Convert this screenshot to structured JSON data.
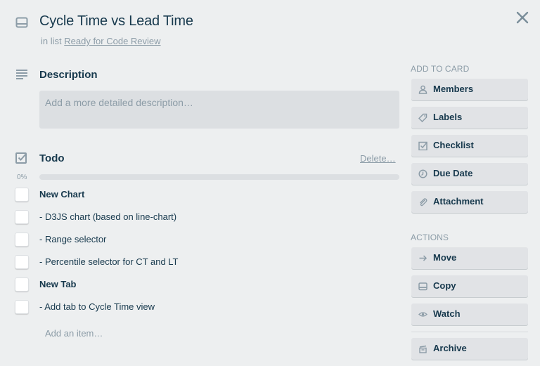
{
  "card": {
    "title": "Cycle Time vs Lead Time",
    "in_list_prefix": "in list",
    "list_name": "Ready for Code Review"
  },
  "description": {
    "heading": "Description",
    "placeholder": "Add a more detailed description…"
  },
  "checklist": {
    "heading": "Todo",
    "delete_label": "Delete…",
    "progress_label": "0%",
    "progress_percent": 0,
    "items": [
      {
        "text": "New Chart",
        "bold": true,
        "checked": false
      },
      {
        "text": "- D3JS chart (based on line-chart)",
        "bold": false,
        "checked": false
      },
      {
        "text": "- Range selector",
        "bold": false,
        "checked": false
      },
      {
        "text": "- Percentile selector for CT and LT",
        "bold": false,
        "checked": false
      },
      {
        "text": "New Tab",
        "bold": true,
        "checked": false
      },
      {
        "text": "- Add tab to Cycle Time view",
        "bold": false,
        "checked": false
      }
    ],
    "add_item_placeholder": "Add an item…"
  },
  "sidebar": {
    "add_to_card_heading": "ADD TO CARD",
    "add_to_card": [
      {
        "label": "Members",
        "icon": "person-icon"
      },
      {
        "label": "Labels",
        "icon": "tag-icon"
      },
      {
        "label": "Checklist",
        "icon": "checkbox-icon"
      },
      {
        "label": "Due Date",
        "icon": "clock-icon"
      },
      {
        "label": "Attachment",
        "icon": "paperclip-icon"
      }
    ],
    "actions_heading": "ACTIONS",
    "actions": [
      {
        "label": "Move",
        "icon": "arrow-right-icon"
      },
      {
        "label": "Copy",
        "icon": "card-icon"
      },
      {
        "label": "Watch",
        "icon": "eye-icon"
      },
      {
        "label": "Archive",
        "icon": "archive-icon"
      }
    ]
  },
  "colors": {
    "text": "#17394d",
    "muted": "#8c9ca7",
    "background": "#edeff0",
    "button": "#e1e3e6"
  }
}
